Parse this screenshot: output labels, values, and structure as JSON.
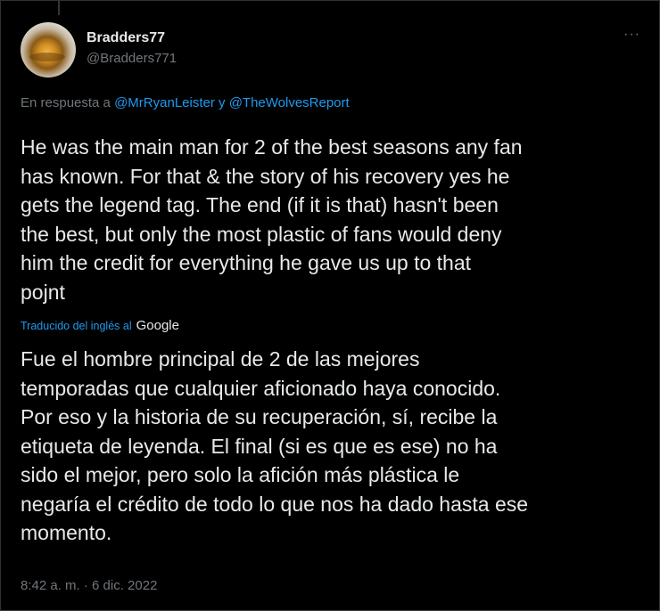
{
  "author": {
    "display_name": "Bradders77",
    "handle": "@Bradders771",
    "avatar_icon": "avatar-image"
  },
  "menu": {
    "more_label": "···"
  },
  "reply": {
    "prefix": "En respuesta a",
    "mention_1": "@MrRyanLeister",
    "joiner": "y",
    "mention_2": "@TheWolvesReport"
  },
  "tweet": {
    "lines": [
      "He was the main man for 2 of the best seasons any fan",
      "has known. For that & the story of his recovery yes he",
      "gets the legend tag. The end (if it is that) hasn't been",
      "the best, but only the most plastic of fans would deny",
      "him the credit for everything he gave us up to that",
      "pojnt"
    ]
  },
  "translation_notice": {
    "label": "Traducido del inglés al",
    "provider": "Google"
  },
  "translation": {
    "lines": [
      "Fue el hombre principal de 2 de las mejores",
      "temporadas que cualquier aficionado haya conocido.",
      "Por eso y la historia de su recuperación, sí, recibe la",
      "etiqueta de leyenda. El final (si es que es ese) no ha",
      "sido el mejor, pero solo la afición más plástica le",
      "negaría el crédito de todo lo que nos ha dado hasta ese",
      "momento."
    ]
  },
  "meta": {
    "timestamp": "8:42 a. m. · 6 dic. 2022"
  },
  "colors": {
    "background": "#000000",
    "text": "#e7e9ea",
    "muted": "#71767b",
    "link": "#1d9bf0"
  }
}
